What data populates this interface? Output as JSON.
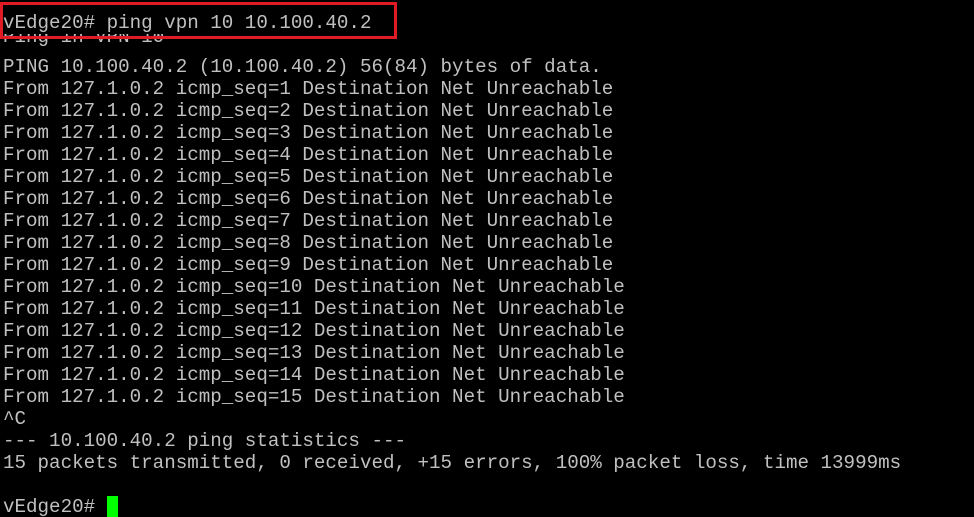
{
  "terminal": {
    "colors": {
      "background": "#000000",
      "text": "#c0c0c0",
      "cursor": "#00ff00",
      "highlight": "#e01b24"
    },
    "command_line": "vEdge20# ping vpn 10 10.100.40.2",
    "output": [
      "Ping in VPN 10",
      "PING 10.100.40.2 (10.100.40.2) 56(84) bytes of data.",
      "From 127.1.0.2 icmp_seq=1 Destination Net Unreachable",
      "From 127.1.0.2 icmp_seq=2 Destination Net Unreachable",
      "From 127.1.0.2 icmp_seq=3 Destination Net Unreachable",
      "From 127.1.0.2 icmp_seq=4 Destination Net Unreachable",
      "From 127.1.0.2 icmp_seq=5 Destination Net Unreachable",
      "From 127.1.0.2 icmp_seq=6 Destination Net Unreachable",
      "From 127.1.0.2 icmp_seq=7 Destination Net Unreachable",
      "From 127.1.0.2 icmp_seq=8 Destination Net Unreachable",
      "From 127.1.0.2 icmp_seq=9 Destination Net Unreachable",
      "From 127.1.0.2 icmp_seq=10 Destination Net Unreachable",
      "From 127.1.0.2 icmp_seq=11 Destination Net Unreachable",
      "From 127.1.0.2 icmp_seq=12 Destination Net Unreachable",
      "From 127.1.0.2 icmp_seq=13 Destination Net Unreachable",
      "From 127.1.0.2 icmp_seq=14 Destination Net Unreachable",
      "From 127.1.0.2 icmp_seq=15 Destination Net Unreachable",
      "^C",
      "--- 10.100.40.2 ping statistics ---",
      "15 packets transmitted, 0 received, +15 errors, 100% packet loss, time 13999ms"
    ],
    "prompt": "vEdge20#"
  }
}
